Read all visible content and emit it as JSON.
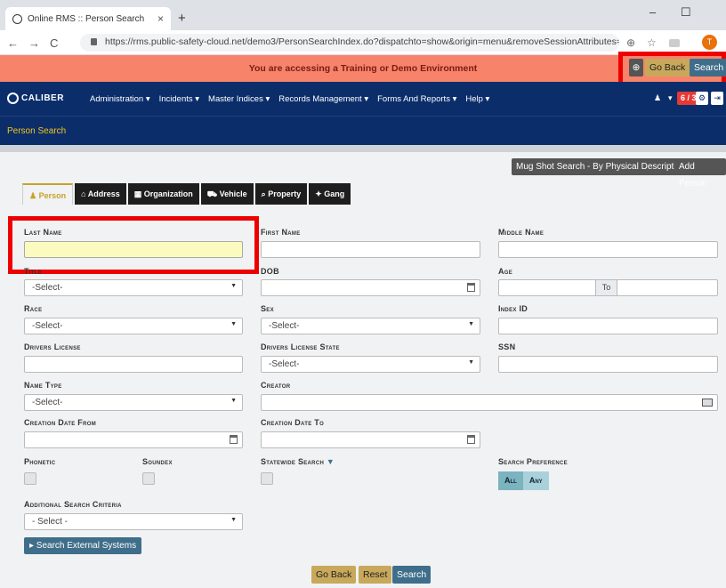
{
  "browser": {
    "tab_title": "Online RMS :: Person Search",
    "tab_close": "×",
    "new_tab": "+",
    "min": "–",
    "max": "☐",
    "url": "https://rms.public-safety-cloud.net/demo3/PersonSearchIndex.do?dispatchto=show&origin=menu&removeSessionAttributes=Y&t...",
    "profile": "T",
    "back": "←",
    "forward": "→",
    "reload": "C",
    "zoom": "⊕",
    "star": "☆"
  },
  "banner": {
    "text": "You are accessing a Training or Demo Environment",
    "go_back": "Go Back",
    "search": "Search",
    "icon": "⊕"
  },
  "nav": {
    "logo": "CALIBER",
    "items": [
      "Administration ▾",
      "Incidents ▾",
      "Master Indices ▾",
      "Records Management ▾",
      "Forms And Reports ▾",
      "Help ▾"
    ],
    "badge": "6 / 3",
    "user_caret": "▾"
  },
  "subbar": {
    "title": "Person Search"
  },
  "actions": {
    "mugshot": "Mug Shot Search - By Physical Description",
    "add_person": "Add Person"
  },
  "tabs": [
    "Person",
    "Address",
    "Organization",
    "Vehicle",
    "Property",
    "Gang"
  ],
  "tab_icons": [
    "♟",
    "⌂",
    "▦",
    "⛟",
    "⌕",
    "✦"
  ],
  "labels": {
    "last_name": "Last Name",
    "first_name": "First Name",
    "middle_name": "Middle Name",
    "title": "Title",
    "dob": "DOB",
    "age": "Age",
    "to": "To",
    "race": "Race",
    "sex": "Sex",
    "index_id": "Index ID",
    "drivers_license": "Drivers License",
    "dl_state": "Drivers License State",
    "ssn": "SSN",
    "name_type": "Name Type",
    "creator": "Creator",
    "creation_from": "Creation Date From",
    "creation_to": "Creation Date To",
    "phonetic": "Phonetic",
    "soundex": "Soundex",
    "statewide": "Statewide Search",
    "search_pref": "Search Preference",
    "additional": "Additional Search Criteria"
  },
  "selects": {
    "title": "-Select-",
    "race": "-Select-",
    "sex": "-Select-",
    "dl_state": "-Select-",
    "name_type": "-Select-",
    "additional": "- Select -"
  },
  "pref": {
    "all": "All",
    "any": "Any"
  },
  "buttons": {
    "external": "▸ Search External Systems",
    "go_back": "Go Back",
    "reset": "Reset",
    "search": "Search"
  },
  "colors": {
    "banner": "#f7836a",
    "navbar": "#0b2e6b",
    "accent": "#c9a227",
    "highlight": "#e00"
  }
}
